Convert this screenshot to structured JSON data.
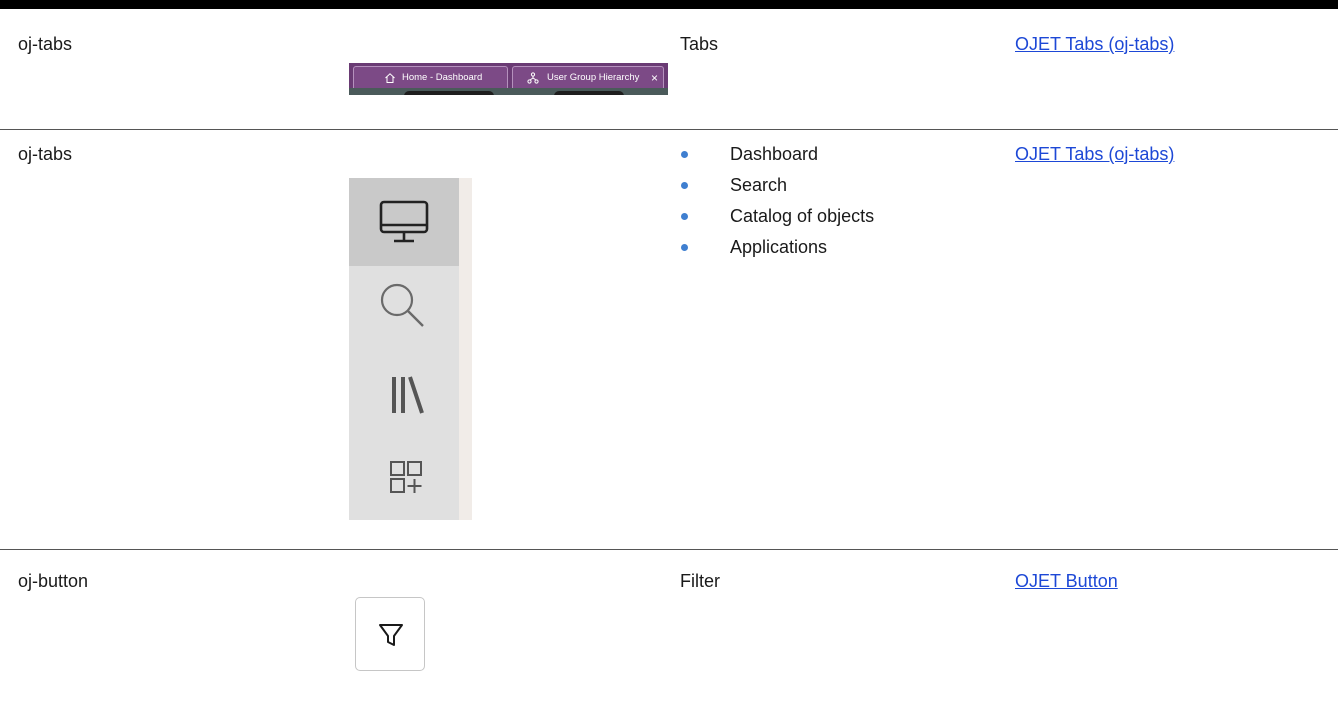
{
  "rows": [
    {
      "component": "oj-tabs",
      "description": "Tabs",
      "link": "OJET Tabs (oj-tabs)",
      "image": {
        "tabs": [
          {
            "label": "Home - Dashboard",
            "icon": "home-icon"
          },
          {
            "label": "User Group Hierarchy",
            "icon": "hierarchy-icon",
            "close": "×"
          }
        ]
      }
    },
    {
      "component": "oj-tabs",
      "items": [
        "Dashboard",
        "Search",
        "Catalog of objects",
        "Applications"
      ],
      "link": "OJET Tabs (oj-tabs)",
      "image": {
        "icons": [
          "monitor-icon",
          "search-icon",
          "library-icon",
          "add-grid-icon"
        ],
        "selected_index": 0
      }
    },
    {
      "component": "oj-button",
      "description": "Filter",
      "link": "OJET Button",
      "image": {
        "icon": "filter-icon"
      }
    }
  ],
  "colors": {
    "link": "#1d48d6",
    "bullet": "#3f7fd0",
    "tab_strip": "#6a3b74"
  }
}
